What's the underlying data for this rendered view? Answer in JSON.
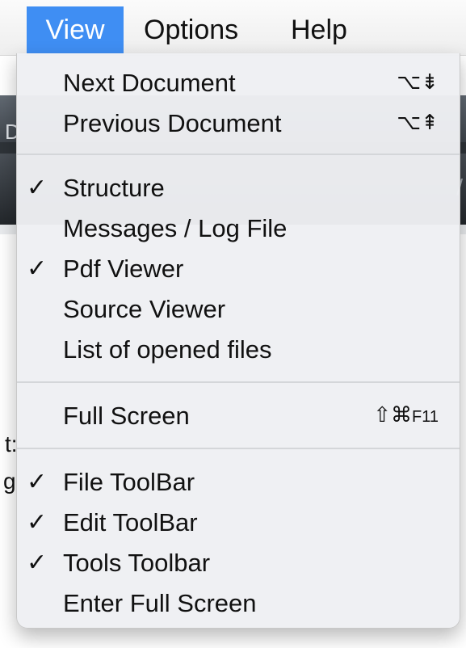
{
  "menubar": {
    "items": [
      {
        "label": "View",
        "active": true
      },
      {
        "label": "Options",
        "active": false
      },
      {
        "label": "Help",
        "active": false
      }
    ]
  },
  "background_fragments": {
    "a": "D",
    "b": "t:",
    "c": "g",
    "d": "/"
  },
  "menu": {
    "accent_color": "#3f8ef3",
    "check_glyph": "✓",
    "items": [
      {
        "label": "Next Document",
        "checked": false,
        "shortcut": "⌥⇟",
        "shortcut_key": ""
      },
      {
        "label": "Previous Document",
        "checked": false,
        "shortcut": "⌥⇞",
        "shortcut_key": ""
      },
      {
        "label": "Structure",
        "checked": true,
        "shortcut": "",
        "shortcut_key": ""
      },
      {
        "label": "Messages / Log File",
        "checked": false,
        "shortcut": "",
        "shortcut_key": ""
      },
      {
        "label": "Pdf Viewer",
        "checked": true,
        "shortcut": "",
        "shortcut_key": ""
      },
      {
        "label": "Source Viewer",
        "checked": false,
        "shortcut": "",
        "shortcut_key": ""
      },
      {
        "label": "List of opened files",
        "checked": false,
        "shortcut": "",
        "shortcut_key": ""
      },
      {
        "label": "Full Screen",
        "checked": false,
        "shortcut": "⇧⌘",
        "shortcut_key": "F11"
      },
      {
        "label": "File ToolBar",
        "checked": true,
        "shortcut": "",
        "shortcut_key": ""
      },
      {
        "label": "Edit ToolBar",
        "checked": true,
        "shortcut": "",
        "shortcut_key": ""
      },
      {
        "label": "Tools Toolbar",
        "checked": true,
        "shortcut": "",
        "shortcut_key": ""
      },
      {
        "label": "Enter Full Screen",
        "checked": false,
        "shortcut": "",
        "shortcut_key": ""
      }
    ]
  }
}
